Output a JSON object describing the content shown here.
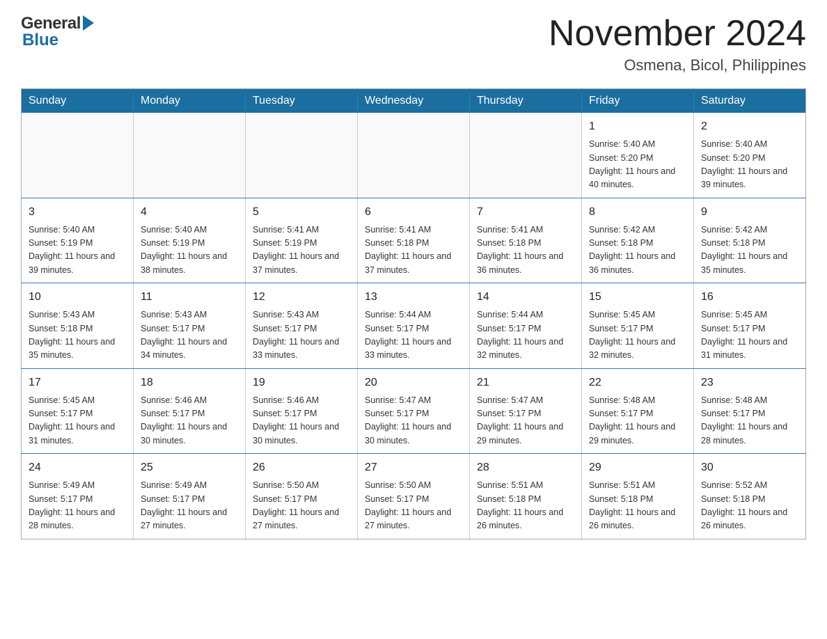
{
  "header": {
    "logo_general": "General",
    "logo_blue": "Blue",
    "month_title": "November 2024",
    "location": "Osmena, Bicol, Philippines"
  },
  "calendar": {
    "days_of_week": [
      "Sunday",
      "Monday",
      "Tuesday",
      "Wednesday",
      "Thursday",
      "Friday",
      "Saturday"
    ],
    "weeks": [
      [
        {
          "day": "",
          "info": ""
        },
        {
          "day": "",
          "info": ""
        },
        {
          "day": "",
          "info": ""
        },
        {
          "day": "",
          "info": ""
        },
        {
          "day": "",
          "info": ""
        },
        {
          "day": "1",
          "info": "Sunrise: 5:40 AM\nSunset: 5:20 PM\nDaylight: 11 hours and 40 minutes."
        },
        {
          "day": "2",
          "info": "Sunrise: 5:40 AM\nSunset: 5:20 PM\nDaylight: 11 hours and 39 minutes."
        }
      ],
      [
        {
          "day": "3",
          "info": "Sunrise: 5:40 AM\nSunset: 5:19 PM\nDaylight: 11 hours and 39 minutes."
        },
        {
          "day": "4",
          "info": "Sunrise: 5:40 AM\nSunset: 5:19 PM\nDaylight: 11 hours and 38 minutes."
        },
        {
          "day": "5",
          "info": "Sunrise: 5:41 AM\nSunset: 5:19 PM\nDaylight: 11 hours and 37 minutes."
        },
        {
          "day": "6",
          "info": "Sunrise: 5:41 AM\nSunset: 5:18 PM\nDaylight: 11 hours and 37 minutes."
        },
        {
          "day": "7",
          "info": "Sunrise: 5:41 AM\nSunset: 5:18 PM\nDaylight: 11 hours and 36 minutes."
        },
        {
          "day": "8",
          "info": "Sunrise: 5:42 AM\nSunset: 5:18 PM\nDaylight: 11 hours and 36 minutes."
        },
        {
          "day": "9",
          "info": "Sunrise: 5:42 AM\nSunset: 5:18 PM\nDaylight: 11 hours and 35 minutes."
        }
      ],
      [
        {
          "day": "10",
          "info": "Sunrise: 5:43 AM\nSunset: 5:18 PM\nDaylight: 11 hours and 35 minutes."
        },
        {
          "day": "11",
          "info": "Sunrise: 5:43 AM\nSunset: 5:17 PM\nDaylight: 11 hours and 34 minutes."
        },
        {
          "day": "12",
          "info": "Sunrise: 5:43 AM\nSunset: 5:17 PM\nDaylight: 11 hours and 33 minutes."
        },
        {
          "day": "13",
          "info": "Sunrise: 5:44 AM\nSunset: 5:17 PM\nDaylight: 11 hours and 33 minutes."
        },
        {
          "day": "14",
          "info": "Sunrise: 5:44 AM\nSunset: 5:17 PM\nDaylight: 11 hours and 32 minutes."
        },
        {
          "day": "15",
          "info": "Sunrise: 5:45 AM\nSunset: 5:17 PM\nDaylight: 11 hours and 32 minutes."
        },
        {
          "day": "16",
          "info": "Sunrise: 5:45 AM\nSunset: 5:17 PM\nDaylight: 11 hours and 31 minutes."
        }
      ],
      [
        {
          "day": "17",
          "info": "Sunrise: 5:45 AM\nSunset: 5:17 PM\nDaylight: 11 hours and 31 minutes."
        },
        {
          "day": "18",
          "info": "Sunrise: 5:46 AM\nSunset: 5:17 PM\nDaylight: 11 hours and 30 minutes."
        },
        {
          "day": "19",
          "info": "Sunrise: 5:46 AM\nSunset: 5:17 PM\nDaylight: 11 hours and 30 minutes."
        },
        {
          "day": "20",
          "info": "Sunrise: 5:47 AM\nSunset: 5:17 PM\nDaylight: 11 hours and 30 minutes."
        },
        {
          "day": "21",
          "info": "Sunrise: 5:47 AM\nSunset: 5:17 PM\nDaylight: 11 hours and 29 minutes."
        },
        {
          "day": "22",
          "info": "Sunrise: 5:48 AM\nSunset: 5:17 PM\nDaylight: 11 hours and 29 minutes."
        },
        {
          "day": "23",
          "info": "Sunrise: 5:48 AM\nSunset: 5:17 PM\nDaylight: 11 hours and 28 minutes."
        }
      ],
      [
        {
          "day": "24",
          "info": "Sunrise: 5:49 AM\nSunset: 5:17 PM\nDaylight: 11 hours and 28 minutes."
        },
        {
          "day": "25",
          "info": "Sunrise: 5:49 AM\nSunset: 5:17 PM\nDaylight: 11 hours and 27 minutes."
        },
        {
          "day": "26",
          "info": "Sunrise: 5:50 AM\nSunset: 5:17 PM\nDaylight: 11 hours and 27 minutes."
        },
        {
          "day": "27",
          "info": "Sunrise: 5:50 AM\nSunset: 5:17 PM\nDaylight: 11 hours and 27 minutes."
        },
        {
          "day": "28",
          "info": "Sunrise: 5:51 AM\nSunset: 5:18 PM\nDaylight: 11 hours and 26 minutes."
        },
        {
          "day": "29",
          "info": "Sunrise: 5:51 AM\nSunset: 5:18 PM\nDaylight: 11 hours and 26 minutes."
        },
        {
          "day": "30",
          "info": "Sunrise: 5:52 AM\nSunset: 5:18 PM\nDaylight: 11 hours and 26 minutes."
        }
      ]
    ]
  }
}
